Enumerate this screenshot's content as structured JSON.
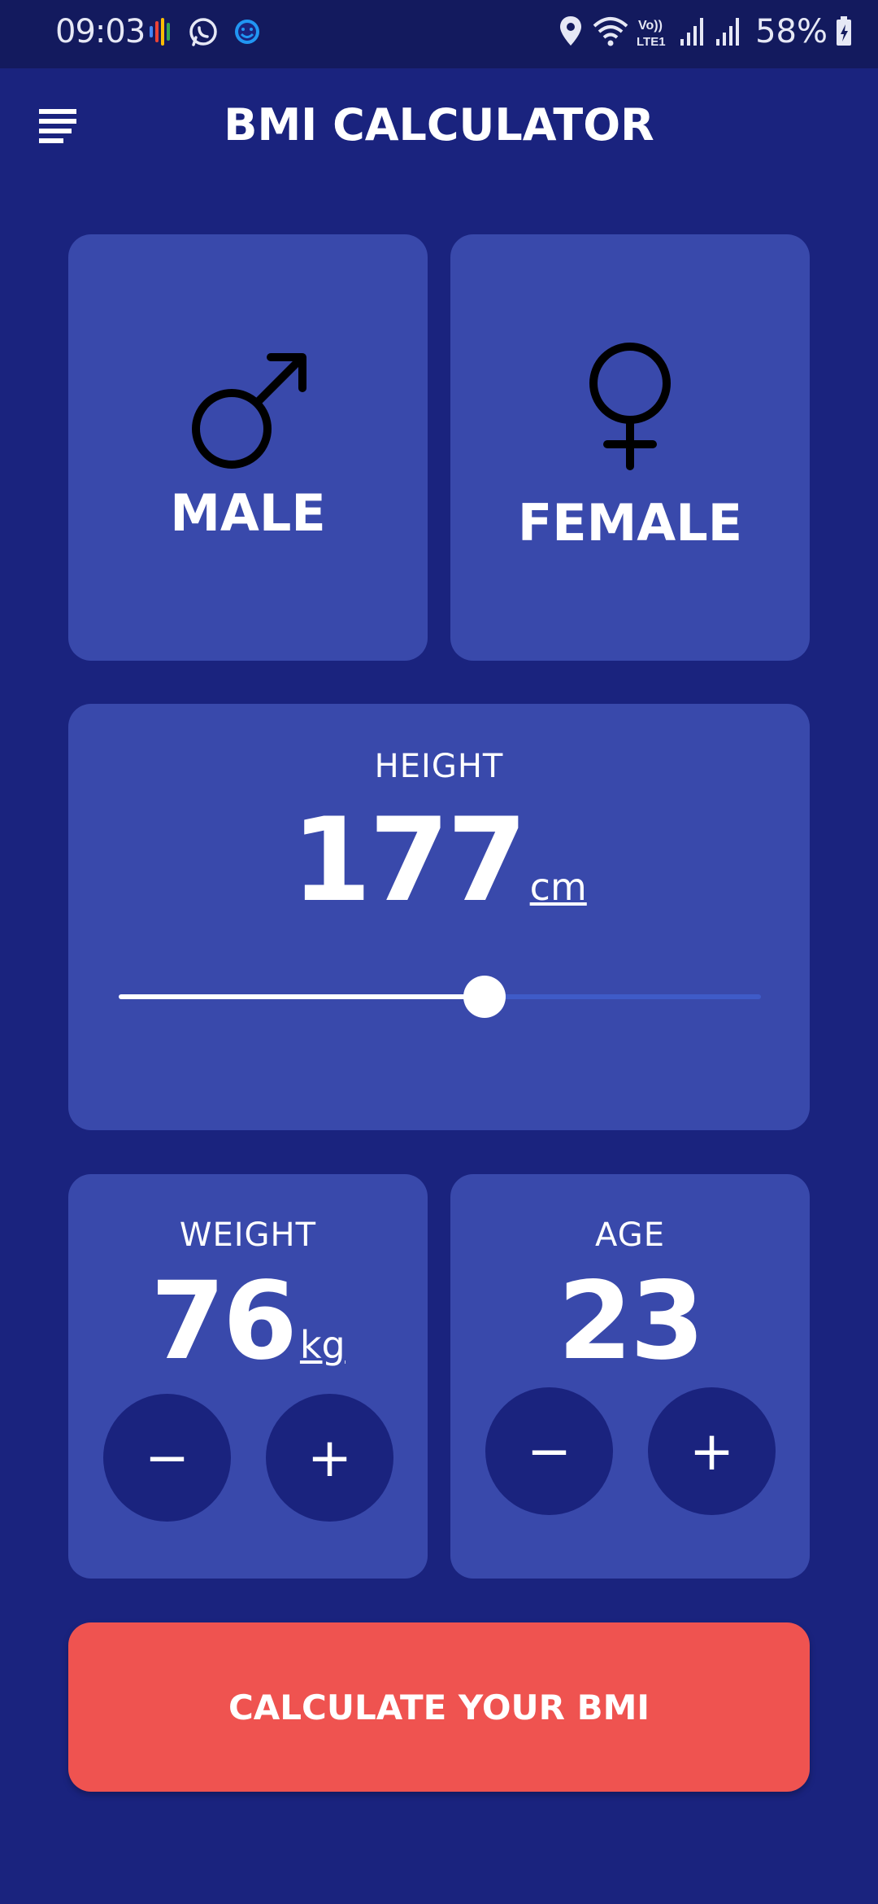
{
  "status_bar": {
    "time": "09:03",
    "left_icons": [
      "podcasts-icon",
      "whatsapp-icon",
      "smiley-icon"
    ],
    "right_icons": [
      "location-icon",
      "wifi-icon",
      "volte-icon",
      "signal-icon",
      "signal-icon",
      "battery-charging-icon"
    ],
    "volte_text": "Vo))\nLTE1",
    "battery": "58%"
  },
  "header": {
    "title": "BMI CALCULATOR",
    "menu_icon": "menu-icon"
  },
  "gender": {
    "male": {
      "label": "MALE",
      "icon": "male-symbol-icon"
    },
    "female": {
      "label": "FEMALE",
      "icon": "female-symbol-icon"
    }
  },
  "height": {
    "label": "HEIGHT",
    "value": "177",
    "unit": "cm",
    "slider_fraction": 0.57
  },
  "weight": {
    "label": "WEIGHT",
    "value": "76",
    "unit": "kg",
    "minus": "−",
    "plus": "+"
  },
  "age": {
    "label": "AGE",
    "value": "23",
    "minus": "−",
    "plus": "+"
  },
  "calculate": {
    "label": "CALCULATE YOUR BMI"
  },
  "colors": {
    "background": "#1a237e",
    "status_bar": "#131a5e",
    "card": "#3949ab",
    "accent_button": "#ef5350",
    "round_button": "#1a237e"
  }
}
